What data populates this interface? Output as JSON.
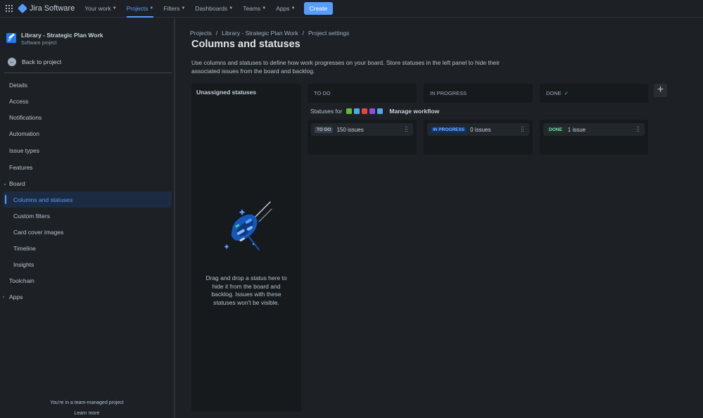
{
  "app": {
    "name": "Jira Software"
  },
  "topnav": {
    "items": [
      {
        "label": "Your work"
      },
      {
        "label": "Projects"
      },
      {
        "label": "Filters"
      },
      {
        "label": "Dashboards"
      },
      {
        "label": "Teams"
      },
      {
        "label": "Apps"
      }
    ],
    "active": "Projects",
    "create_label": "Create"
  },
  "sidebar": {
    "project_name": "Library - Strategic Plan Work",
    "project_type": "Software project",
    "back_label": "Back to project",
    "items": [
      {
        "label": "Details"
      },
      {
        "label": "Access"
      },
      {
        "label": "Notifications"
      },
      {
        "label": "Automation"
      },
      {
        "label": "Issue types"
      },
      {
        "label": "Features"
      },
      {
        "label": "Board"
      },
      {
        "label": "Columns and statuses"
      },
      {
        "label": "Custom filters"
      },
      {
        "label": "Card cover images"
      },
      {
        "label": "Timeline"
      },
      {
        "label": "Insights"
      },
      {
        "label": "Toolchain"
      },
      {
        "label": "Apps"
      }
    ],
    "selected": "Columns and statuses",
    "footer_text": "You're in a team-managed project",
    "footer_link": "Learn more"
  },
  "breadcrumb": [
    "Projects",
    "Library - Strategic Plan Work",
    "Project settings"
  ],
  "page": {
    "title": "Columns and statuses",
    "description": "Use columns and statuses to define how work progresses on your board. Store statuses in the left panel to hide their associated issues from the board and backlog."
  },
  "unassigned": {
    "title": "Unassigned statuses",
    "empty_text": "Drag and drop a status here to hide it from the board and backlog. Issues with these statuses won't be visible."
  },
  "statuses_for": {
    "label": "Statuses for",
    "issue_type_icons": [
      {
        "name": "story-icon",
        "color": "#63ba3c"
      },
      {
        "name": "task-icon",
        "color": "#4bade8"
      },
      {
        "name": "bug-icon",
        "color": "#e5493a"
      },
      {
        "name": "epic-icon",
        "color": "#904ee2"
      },
      {
        "name": "subtask-icon",
        "color": "#4bade8"
      }
    ],
    "manage_label": "Manage workflow"
  },
  "columns": [
    {
      "header": "TO DO",
      "status": "TO DO",
      "count": "150 issues",
      "color": "#38414a"
    },
    {
      "header": "IN PROGRESS",
      "status": "IN PROGRESS",
      "count": "0 issues",
      "color": "#09326c"
    },
    {
      "header": "DONE",
      "status": "DONE",
      "count": "1 issue",
      "color": "#1c3329",
      "done_check": "✓"
    }
  ],
  "add_column_label": "+"
}
